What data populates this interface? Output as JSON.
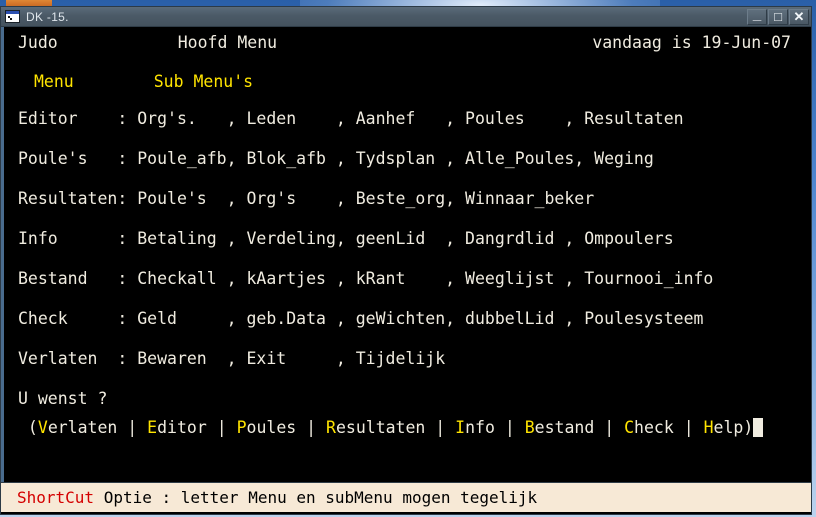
{
  "window": {
    "title": "DK -15.",
    "icon": "console-icon",
    "controls": {
      "minimize": "_",
      "maximize": "□",
      "close": "✕"
    }
  },
  "screen": {
    "header": {
      "app_name": "Judo",
      "title": "Hoofd Menu",
      "date_label": "vandaag is 19-Jun-07"
    },
    "column_headers": {
      "menu": "Menu",
      "submenu": "Sub Menu's"
    },
    "menu_rows": [
      {
        "label": "Editor",
        "line": "Editor    : Org's.   , Leden    , Aanhef   , Poules    , Resultaten",
        "submenus": [
          "Org's.",
          "Leden",
          "Aanhef",
          "Poules",
          "Resultaten"
        ]
      },
      {
        "label": "Poule's",
        "line": "Poule's   : Poule_afb, Blok_afb , Tydsplan , Alle_Poules, Weging",
        "submenus": [
          "Poule_afb",
          "Blok_afb",
          "Tydsplan",
          "Alle_Poules",
          "Weging"
        ]
      },
      {
        "label": "Resultaten",
        "line": "Resultaten: Poule's  , Org's    , Beste_org, Winnaar_beker",
        "submenus": [
          "Poule's",
          "Org's",
          "Beste_org",
          "Winnaar_beker"
        ]
      },
      {
        "label": "Info",
        "line": "Info      : Betaling , Verdeling, geenLid  , Dangrdlid , Ompoulers",
        "submenus": [
          "Betaling",
          "Verdeling",
          "geenLid",
          "Dangrdlid",
          "Ompoulers"
        ]
      },
      {
        "label": "Bestand",
        "line": "Bestand   : Checkall , kAartjes , kRant    , Weeglijst , Tournooi_info",
        "submenus": [
          "Checkall",
          "kAartjes",
          "kRant",
          "Weeglijst",
          "Tournooi_info"
        ]
      },
      {
        "label": "Check",
        "line": "Check     : Geld     , geb.Data , geWichten, dubbelLid , Poulesysteem",
        "submenus": [
          "Geld",
          "geb.Data",
          "geWichten",
          "dubbelLid",
          "Poulesysteem"
        ]
      },
      {
        "label": "Verlaten",
        "line": "Verlaten  : Bewaren  , Exit     , Tijdelijk",
        "submenus": [
          "Bewaren",
          "Exit",
          "Tijdelijk"
        ]
      }
    ],
    "prompt": {
      "question": "U wenst ?",
      "open_paren": " (",
      "close_paren": ")",
      "separator": " | ",
      "options": [
        {
          "key": "V",
          "rest": "erlaten"
        },
        {
          "key": "E",
          "rest": "ditor"
        },
        {
          "key": "P",
          "rest": "oules"
        },
        {
          "key": "R",
          "rest": "esultaten"
        },
        {
          "key": "I",
          "rest": "nfo"
        },
        {
          "key": "B",
          "rest": "estand"
        },
        {
          "key": "C",
          "rest": "heck"
        },
        {
          "key": "H",
          "rest": "elp"
        }
      ]
    }
  },
  "statusbar": {
    "key": "ShortCut",
    "text": " Optie : letter Menu en subMenu mogen tegelijk"
  },
  "colors": {
    "terminal_bg": "#000000",
    "terminal_fg": "#f0ece0",
    "accent_yellow": "#ffe400",
    "status_bg": "#f7e9d6",
    "status_key_red": "#d40000",
    "titlebar": "#4b5a67"
  }
}
